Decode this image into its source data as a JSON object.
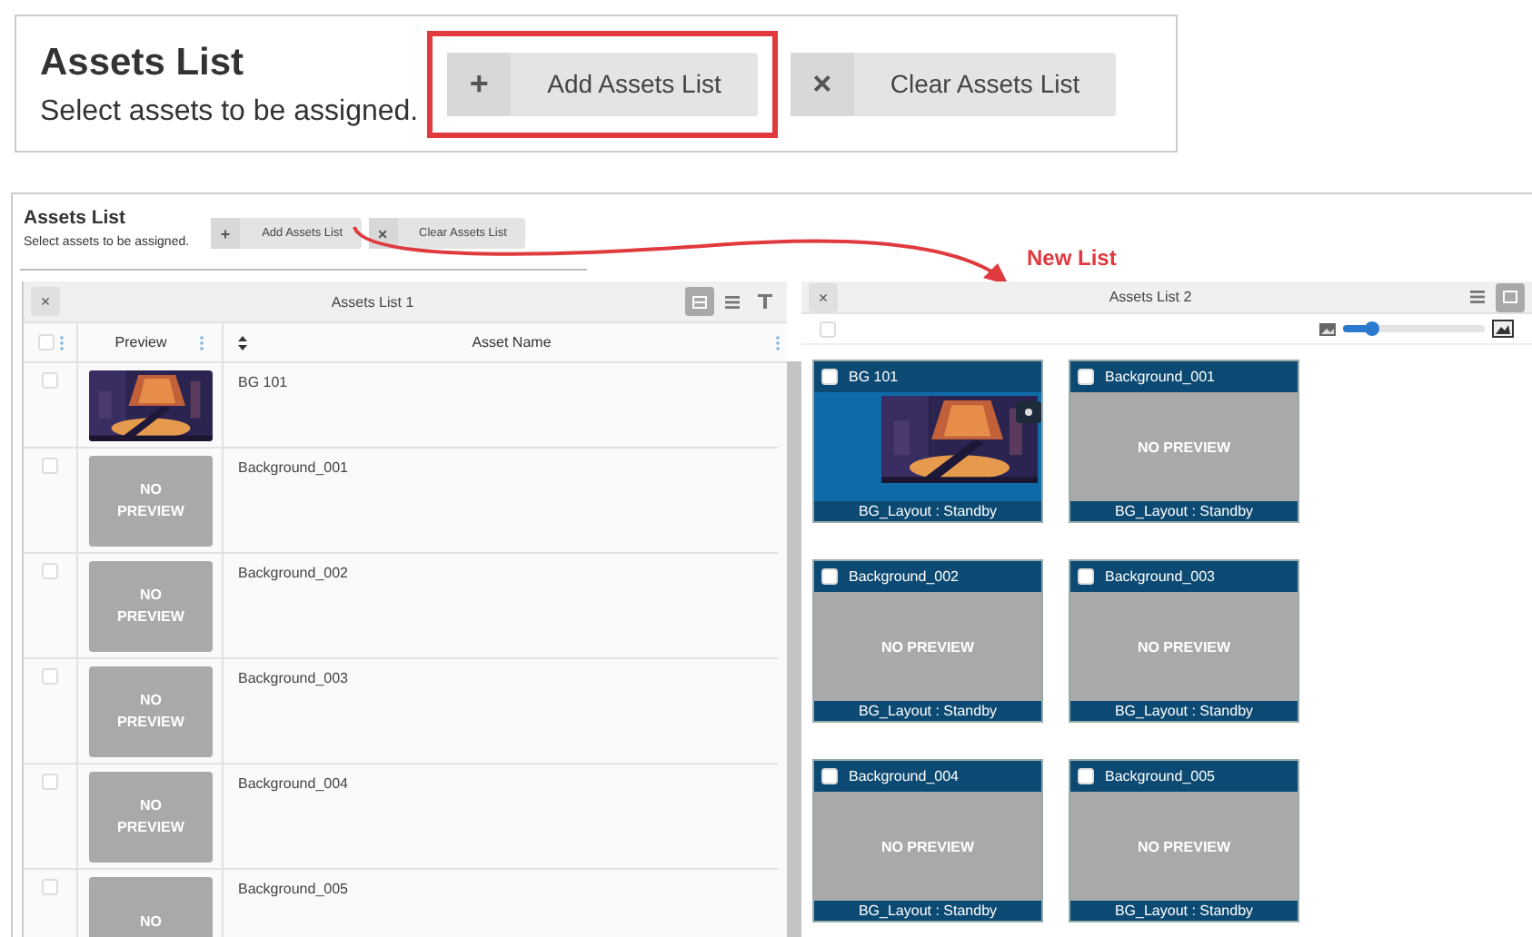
{
  "callout": {
    "title": "Assets List",
    "subtitle": "Select assets to be assigned.",
    "buttons": [
      {
        "icon": "+",
        "label": "Add Assets List",
        "highlighted": true
      },
      {
        "icon": "×",
        "label": "Clear Assets List",
        "highlighted": false
      }
    ]
  },
  "panel": {
    "title": "Assets List",
    "subtitle": "Select assets to be assigned.",
    "buttons": [
      {
        "icon": "+",
        "label": "Add Assets List"
      },
      {
        "icon": "×",
        "label": "Clear Assets List"
      }
    ]
  },
  "annotation": {
    "label": "New List"
  },
  "list_1": {
    "close": "×",
    "title": "Assets List 1",
    "view_buttons": [
      {
        "kind": "grid",
        "selected": true
      },
      {
        "kind": "list",
        "selected": false
      },
      {
        "kind": "filter",
        "selected": false
      }
    ],
    "select_all": {
      "checked": false
    },
    "columns": [
      "Preview",
      "Asset Name"
    ],
    "rows": [
      {
        "name": "BG 101",
        "kind": "picture",
        "checked": false
      },
      {
        "name": "Background_001",
        "kind": "no_preview",
        "preview_text": "NO PREVIEW",
        "checked": false
      },
      {
        "name": "Background_002",
        "kind": "no_preview",
        "preview_text": "NO PREVIEW",
        "checked": false
      },
      {
        "name": "Background_003",
        "kind": "no_preview",
        "preview_text": "NO PREVIEW",
        "checked": false
      },
      {
        "name": "Background_004",
        "kind": "no_preview",
        "preview_text": "NO PREVIEW",
        "checked": false
      },
      {
        "name": "Background_005",
        "kind": "no_preview",
        "preview_text": "NO",
        "checked": false
      }
    ]
  },
  "list_2": {
    "close": "×",
    "title": "Assets List 2",
    "view_buttons": [
      {
        "kind": "list",
        "selected": false
      },
      {
        "kind": "grid",
        "selected": true
      }
    ],
    "select_all": {
      "checked": false
    },
    "thumbnail_size": {
      "level": 0.2
    },
    "cards": [
      {
        "name": "BG 101",
        "kind": "picture",
        "status": "BG_Layout : Standby",
        "checked": false
      },
      {
        "name": "Background_001",
        "kind": "no_preview",
        "preview_text": "NO PREVIEW",
        "status": "BG_Layout : Standby",
        "checked": false
      },
      {
        "name": "Background_002",
        "kind": "no_preview",
        "preview_text": "NO PREVIEW",
        "status": "BG_Layout : Standby",
        "checked": false
      },
      {
        "name": "Background_003",
        "kind": "no_preview",
        "preview_text": "NO PREVIEW",
        "status": "BG_Layout : Standby",
        "checked": false
      },
      {
        "name": "Background_004",
        "kind": "no_preview",
        "preview_text": "NO PREVIEW",
        "status": "BG_Layout : Standby",
        "checked": false
      },
      {
        "name": "Background_005",
        "kind": "no_preview",
        "preview_text": "NO PREVIEW",
        "status": "BG_Layout : Standby",
        "checked": false
      }
    ]
  }
}
